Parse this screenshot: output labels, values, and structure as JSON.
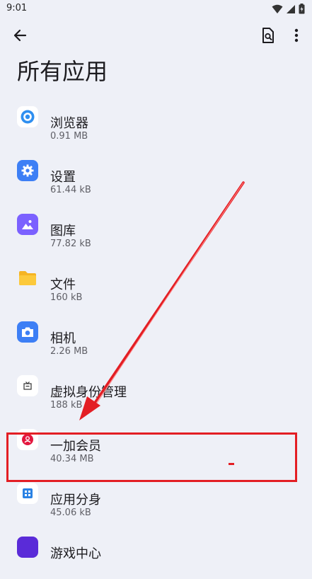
{
  "status_bar": {
    "time": "9:01"
  },
  "header": {
    "title": "所有应用"
  },
  "apps": [
    {
      "name": "浏览器",
      "size": "0.91 MB",
      "icon": "browser-icon"
    },
    {
      "name": "设置",
      "size": "61.44 kB",
      "icon": "settings-gear-icon"
    },
    {
      "name": "图库",
      "size": "77.82 kB",
      "icon": "gallery-icon"
    },
    {
      "name": "文件",
      "size": "160 kB",
      "icon": "folder-icon"
    },
    {
      "name": "相机",
      "size": "2.26 MB",
      "icon": "camera-icon"
    },
    {
      "name": "虚拟身份管理",
      "size": "188 kB",
      "icon": "virtual-id-icon"
    },
    {
      "name": "一加会员",
      "size": "40.34 MB",
      "icon": "member-icon"
    },
    {
      "name": "应用分身",
      "size": "45.06 kB",
      "icon": "app-clone-icon"
    },
    {
      "name": "游戏中心",
      "size": "",
      "icon": "game-center-icon"
    }
  ],
  "colors": {
    "background": "#eef0f7",
    "accent_blue": "#3d7ff5",
    "annotation_red": "#e31e24"
  }
}
